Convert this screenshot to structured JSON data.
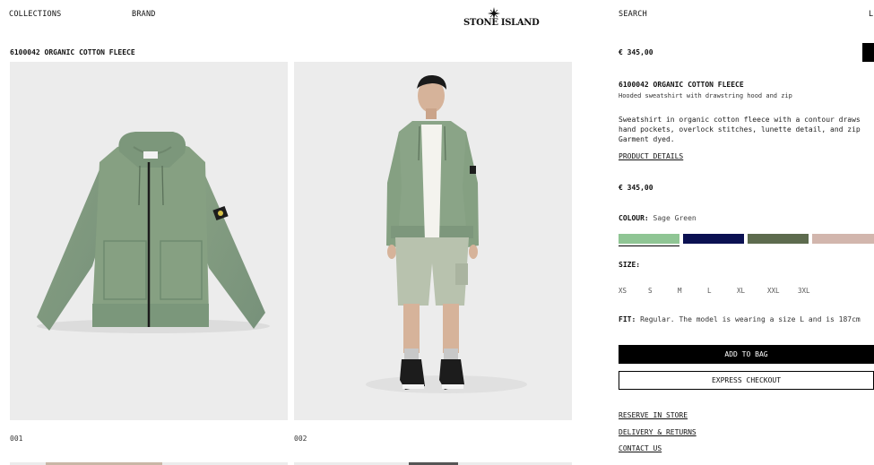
{
  "header": {
    "collections": "COLLECTIONS",
    "brand": "BRAND",
    "logo_text": "STONE ISLAND",
    "search": "SEARCH",
    "right_cut": "L"
  },
  "product_title_top": "6100042 ORGANIC COTTON FLEECE",
  "gallery": {
    "images": [
      {
        "caption": "001",
        "alt": "Sage green hooded zip sweatshirt, flat lay"
      },
      {
        "caption": "002",
        "alt": "Model wearing sage green hoodie and shorts"
      }
    ]
  },
  "panel": {
    "price_top": "€ 345,00",
    "name": "6100042 ORGANIC COTTON FLEECE",
    "subtitle": "Hooded sweatshirt with drawstring hood and zip",
    "description": [
      "Sweatshirt in organic cotton fleece with a contour draws",
      "hand pockets, overlock stitches, lunette detail, and zip",
      "Garment dyed."
    ],
    "product_details": "PRODUCT DETAILS",
    "price": "€ 345,00",
    "colour_label": "COLOUR:",
    "colour_value": "Sage Green",
    "swatches": [
      {
        "name": "Sage Green",
        "color": "#8fc594"
      },
      {
        "name": "Navy",
        "color": "#0b1152"
      },
      {
        "name": "Olive",
        "color": "#5d6b4e"
      },
      {
        "name": "Rose",
        "color": "#d2b6ad"
      }
    ],
    "size_label": "SIZE:",
    "sizes": [
      "XS",
      "S",
      "M",
      "L",
      "XL",
      "XXL",
      "3XL"
    ],
    "fit_label": "FIT:",
    "fit_text": "Regular. The model is wearing a size L and is 187cm",
    "add_to_bag": "ADD TO BAG",
    "express_checkout": "EXPRESS CHECKOUT",
    "reserve": "RESERVE IN STORE",
    "delivery": "DELIVERY & RETURNS",
    "contact": "CONTACT US"
  }
}
